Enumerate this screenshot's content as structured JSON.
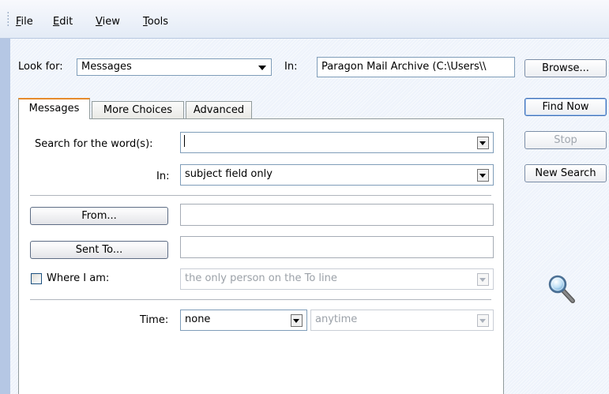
{
  "menu": {
    "items": [
      {
        "mnemonic": "F",
        "rest": "ile"
      },
      {
        "mnemonic": "E",
        "rest": "dit"
      },
      {
        "mnemonic": "V",
        "rest": "iew"
      },
      {
        "mnemonic": "T",
        "rest": "ools"
      }
    ]
  },
  "toolbar": {
    "look_for_label": "Look for:",
    "look_for_value": "Messages",
    "in_label": "In:",
    "in_value": "Paragon Mail Archive (C:\\Users\\\\",
    "browse_label": "Browse..."
  },
  "tabs": [
    {
      "label": "Messages",
      "active": true
    },
    {
      "label": "More Choices",
      "active": false
    },
    {
      "label": "Advanced",
      "active": false
    }
  ],
  "form": {
    "search_words_label": "Search for the word(s):",
    "search_words_value": "",
    "in_label": "In:",
    "in_value": "subject field only",
    "from_button": "From...",
    "from_value": "",
    "sent_to_button": "Sent To...",
    "sent_to_value": "",
    "where_label": "Where I am:",
    "where_checked": false,
    "where_value": "the only person on the To line",
    "time_label": "Time:",
    "time_value": "none",
    "time_range_value": "anytime"
  },
  "actions": {
    "find_now": "Find Now",
    "stop": "Stop",
    "new_search": "New Search"
  },
  "icons": {
    "search": "magnifier-icon"
  }
}
